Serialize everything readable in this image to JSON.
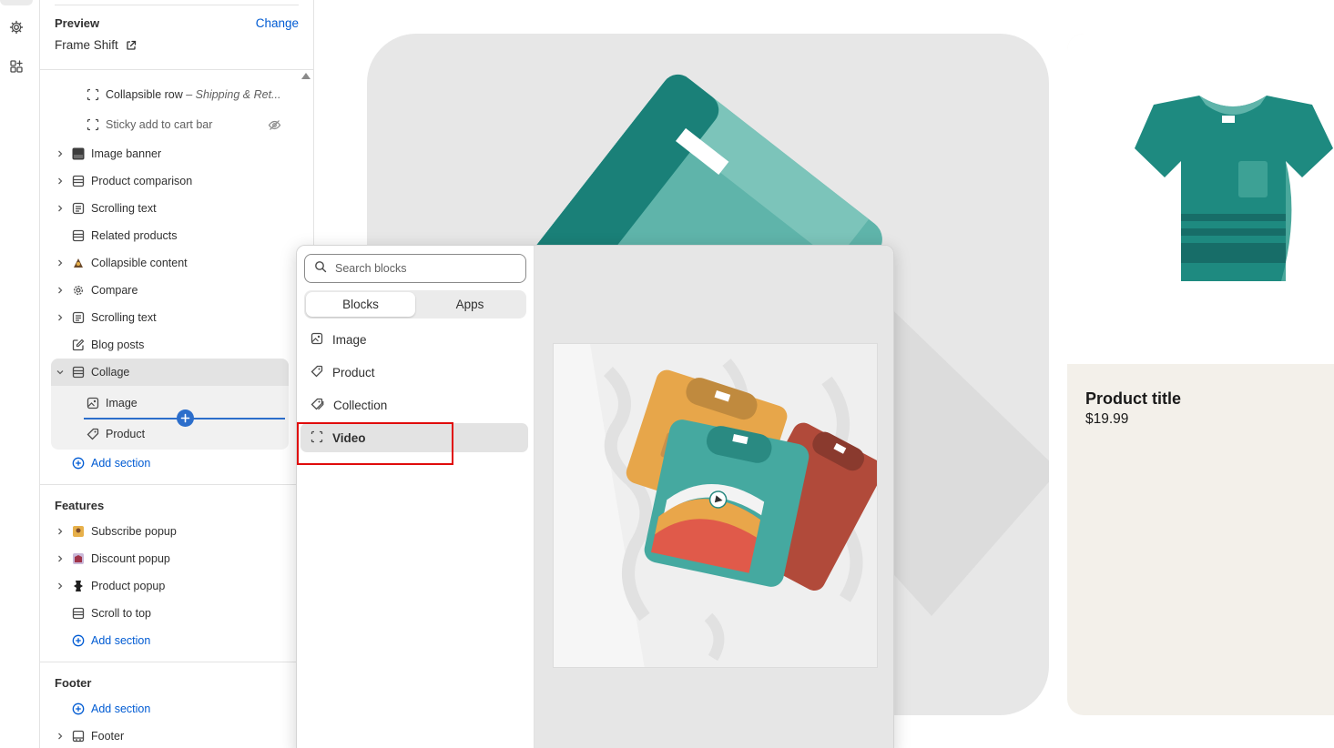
{
  "preview": {
    "title": "Preview",
    "change_label": "Change",
    "theme_name": "Frame Shift"
  },
  "template_rows": [
    {
      "label": "Collapsible row",
      "subtitle": " – Shipping & Ret..."
    },
    {
      "label": "Sticky add to cart bar"
    },
    {
      "label": "Image banner"
    },
    {
      "label": "Product comparison"
    },
    {
      "label": "Scrolling text"
    },
    {
      "label": "Related products"
    },
    {
      "label": "Collapsible content"
    },
    {
      "label": "Compare"
    },
    {
      "label": "Scrolling text"
    },
    {
      "label": "Blog posts"
    },
    {
      "label": "Collage"
    }
  ],
  "collage_children": [
    {
      "label": "Image"
    },
    {
      "label": "Product"
    }
  ],
  "add_section_label": "Add section",
  "features": {
    "title": "Features",
    "rows": [
      {
        "label": "Subscribe popup"
      },
      {
        "label": "Discount popup"
      },
      {
        "label": "Product popup"
      },
      {
        "label": "Scroll to top"
      }
    ]
  },
  "footer": {
    "title": "Footer",
    "rows": [
      {
        "label": "Footer"
      }
    ]
  },
  "picker": {
    "search_placeholder": "Search blocks",
    "tabs": [
      {
        "label": "Blocks",
        "active": true
      },
      {
        "label": "Apps",
        "active": false
      }
    ],
    "items": [
      {
        "label": "Image",
        "icon": "image-icon"
      },
      {
        "label": "Product",
        "icon": "tag-icon"
      },
      {
        "label": "Collection",
        "icon": "tags-icon"
      },
      {
        "label": "Video",
        "icon": "video-block-icon",
        "selected": true
      }
    ]
  },
  "product_card": {
    "title": "Product title",
    "price": "$19.99"
  },
  "colors": {
    "accent": "#005bd3",
    "highlight": "#e00b0b",
    "teal": "#1e8a80",
    "insert": "#2c6ecb"
  }
}
